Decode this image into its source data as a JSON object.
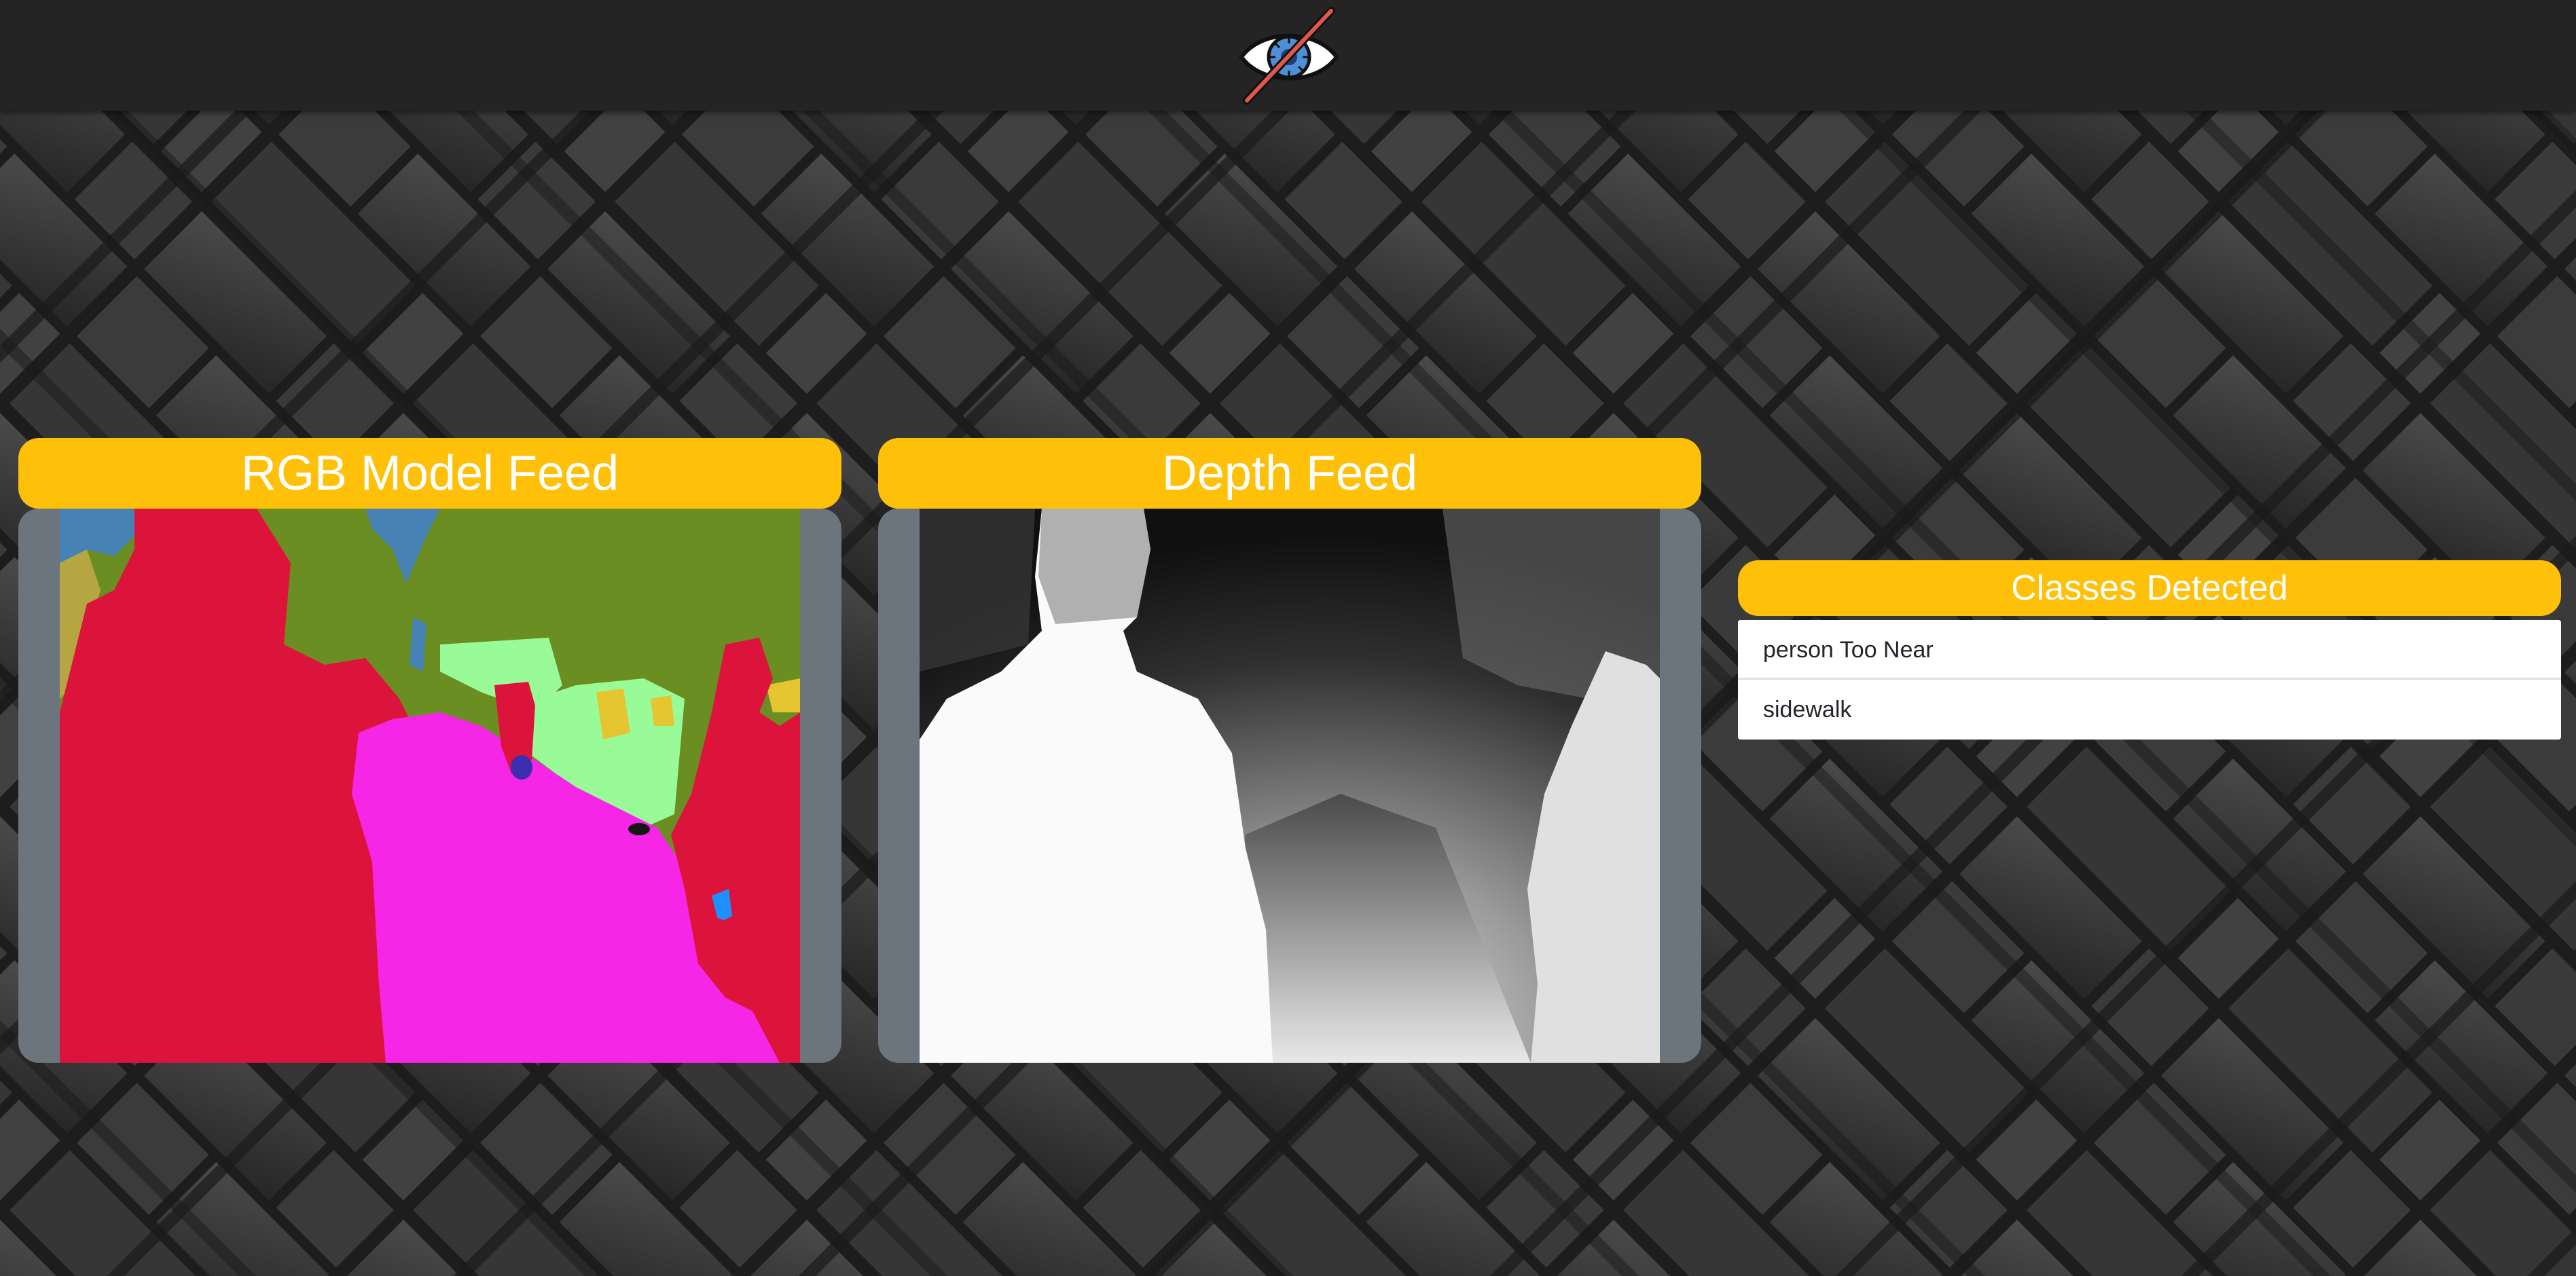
{
  "header": {
    "logo_icon": "eye-slash-icon"
  },
  "rgb_feed": {
    "title": "RGB Model Feed"
  },
  "depth_feed": {
    "title": "Depth Feed"
  },
  "classes_panel": {
    "title": "Classes Detected",
    "items": [
      {
        "label": "person Too Near"
      },
      {
        "label": "sidewalk"
      }
    ]
  },
  "colors": {
    "accent": "#fec008",
    "topbar": "#242424",
    "feed_frame": "#6c757d",
    "background": "#2d2d2d"
  }
}
